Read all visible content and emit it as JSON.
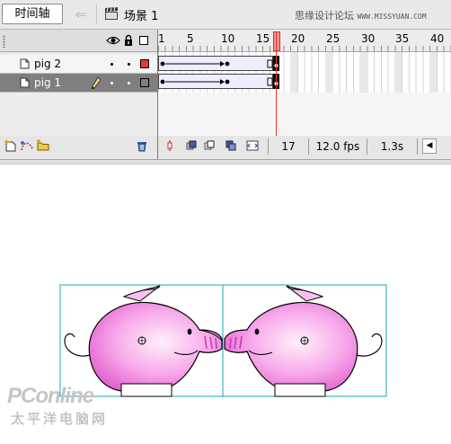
{
  "topbar": {
    "timeline_tab": "时间轴",
    "back_icon": "back-arrow-icon",
    "scene_icon": "clapperboard-icon",
    "scene_label": "场景 1",
    "watermark_cn": "思缘设计论坛",
    "watermark_url": "WWW.MISSYUAN.COM"
  },
  "layers_header": {
    "visibility_icon": "eye-icon",
    "lock_icon": "lock-icon",
    "outline_icon": "outline-square-icon"
  },
  "layers": [
    {
      "name": "pig 2",
      "selected": false,
      "color": "#e8392b"
    },
    {
      "name": "pig 1",
      "selected": true,
      "color": "#7f7f7f"
    }
  ],
  "ruler": {
    "labels": [
      "1",
      "5",
      "10",
      "15",
      "20",
      "25",
      "30",
      "35",
      "40"
    ]
  },
  "status": {
    "current_frame": "17",
    "frame_rate": "12.0 fps",
    "elapsed": "1.3s"
  },
  "colors": {
    "panel_bg": "#e9e9e9",
    "playhead": "#e8392b",
    "tween_fill": "#eceefd",
    "pig_pink": "#f07fe0",
    "guide_cyan": "#1fa3b8"
  },
  "brand": {
    "main": "PConline",
    "sub": "太平洋电脑网"
  }
}
